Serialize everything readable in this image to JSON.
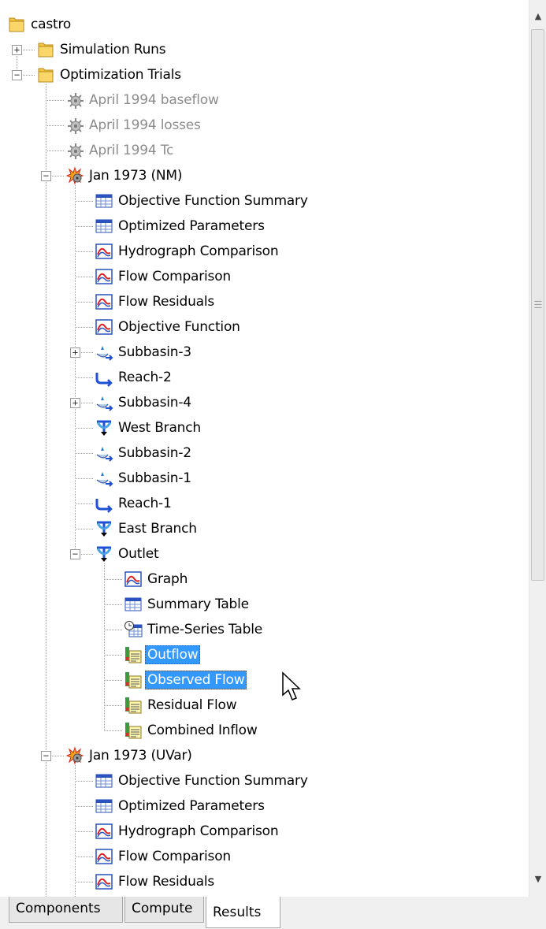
{
  "tree": [
    {
      "label": "castro",
      "level": 0,
      "icon": "folder-icon",
      "last": true
    },
    {
      "label": "Simulation Runs",
      "level": 1,
      "icon": "folder-icon",
      "toggle": "collapsed"
    },
    {
      "label": "Optimization Trials",
      "level": 1,
      "icon": "folder-icon",
      "toggle": "expanded",
      "last": true
    },
    {
      "label": "April 1994 baseflow",
      "level": 2,
      "icon": "trial-inactive-icon",
      "dim": true
    },
    {
      "label": "April 1994 losses",
      "level": 2,
      "icon": "trial-inactive-icon",
      "dim": true
    },
    {
      "label": "April 1994 Tc",
      "level": 2,
      "icon": "trial-inactive-icon",
      "dim": true
    },
    {
      "label": "Jan 1973 (NM)",
      "level": 2,
      "icon": "trial-active-icon",
      "toggle": "expanded"
    },
    {
      "label": "Objective Function Summary",
      "level": 3,
      "icon": "table-icon"
    },
    {
      "label": "Optimized Parameters",
      "level": 3,
      "icon": "table-icon"
    },
    {
      "label": "Hydrograph Comparison",
      "level": 3,
      "icon": "graph-icon"
    },
    {
      "label": "Flow Comparison",
      "level": 3,
      "icon": "graph-icon"
    },
    {
      "label": "Flow Residuals",
      "level": 3,
      "icon": "graph-icon"
    },
    {
      "label": "Objective Function",
      "level": 3,
      "icon": "graph-icon"
    },
    {
      "label": "Subbasin-3",
      "level": 3,
      "icon": "subbasin-icon",
      "toggle": "collapsed"
    },
    {
      "label": "Reach-2",
      "level": 3,
      "icon": "reach-icon"
    },
    {
      "label": "Subbasin-4",
      "level": 3,
      "icon": "subbasin-icon",
      "toggle": "collapsed"
    },
    {
      "label": "West Branch",
      "level": 3,
      "icon": "junction-icon"
    },
    {
      "label": "Subbasin-2",
      "level": 3,
      "icon": "subbasin-icon"
    },
    {
      "label": "Subbasin-1",
      "level": 3,
      "icon": "subbasin-icon"
    },
    {
      "label": "Reach-1",
      "level": 3,
      "icon": "reach-icon"
    },
    {
      "label": "East Branch",
      "level": 3,
      "icon": "junction-icon"
    },
    {
      "label": "Outlet",
      "level": 3,
      "icon": "junction-icon",
      "toggle": "expanded",
      "last": true
    },
    {
      "label": "Graph",
      "level": 4,
      "icon": "graph-icon"
    },
    {
      "label": "Summary Table",
      "level": 4,
      "icon": "table-icon"
    },
    {
      "label": "Time-Series Table",
      "level": 4,
      "icon": "time-series-table-icon"
    },
    {
      "label": "Outflow",
      "level": 4,
      "icon": "time-series-icon",
      "selected": true
    },
    {
      "label": "Observed Flow",
      "level": 4,
      "icon": "time-series-icon",
      "selected": true
    },
    {
      "label": "Residual Flow",
      "level": 4,
      "icon": "time-series-icon"
    },
    {
      "label": "Combined Inflow",
      "level": 4,
      "icon": "time-series-icon",
      "last": true
    },
    {
      "label": "Jan 1973 (UVar)",
      "level": 2,
      "icon": "trial-active-icon",
      "toggle": "expanded"
    },
    {
      "label": "Objective Function Summary",
      "level": 3,
      "icon": "table-icon"
    },
    {
      "label": "Optimized Parameters",
      "level": 3,
      "icon": "table-icon"
    },
    {
      "label": "Hydrograph Comparison",
      "level": 3,
      "icon": "graph-icon"
    },
    {
      "label": "Flow Comparison",
      "level": 3,
      "icon": "graph-icon"
    },
    {
      "label": "Flow Residuals",
      "level": 3,
      "icon": "graph-icon"
    }
  ],
  "tabs": [
    {
      "label": "Components"
    },
    {
      "label": "Compute"
    },
    {
      "label": "Results",
      "active": true
    }
  ],
  "colors": {
    "selection": "#3399ff",
    "folder": "#f5c642",
    "graph_red": "#e02020",
    "table_blue": "#2a52be",
    "element_blue": "#1e4fd8"
  }
}
